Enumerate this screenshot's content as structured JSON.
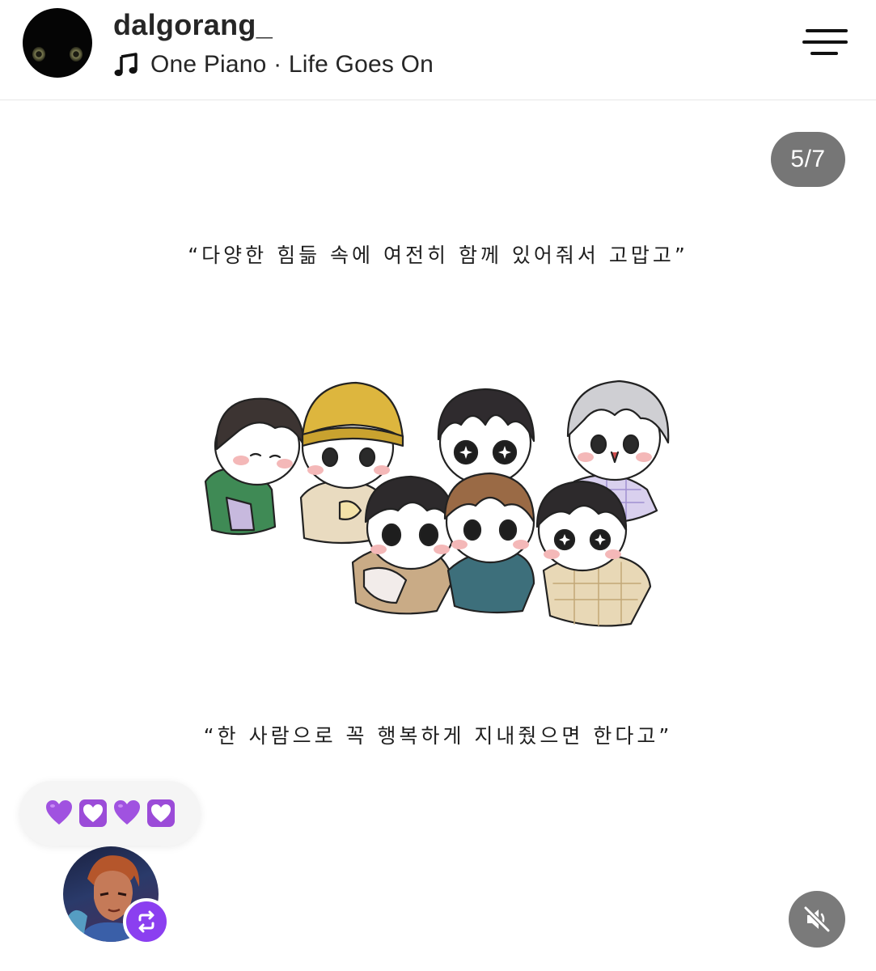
{
  "header": {
    "username": "dalgorang_",
    "music": "One Piano · Life Goes On",
    "avatar_icon": "black-cat-icon",
    "music_icon": "music-note-icon",
    "menu_icon": "hamburger-menu-icon"
  },
  "slide": {
    "counter": "5/7",
    "quote_top": "“다양한 힘듦 속에 여전히 함께 있어줘서 고맙고”",
    "quote_bottom": "“한 사람으로 꼭 행복하게 지내줬으면 한다고”"
  },
  "reaction": {
    "emojis": [
      "purple-heart",
      "heart-decoration",
      "purple-heart",
      "heart-decoration"
    ],
    "accent": "#a052e0"
  },
  "footer": {
    "repost_icon": "repost-icon",
    "mute_icon": "speaker-muted-icon",
    "repost_color": "#8b3ff0"
  }
}
